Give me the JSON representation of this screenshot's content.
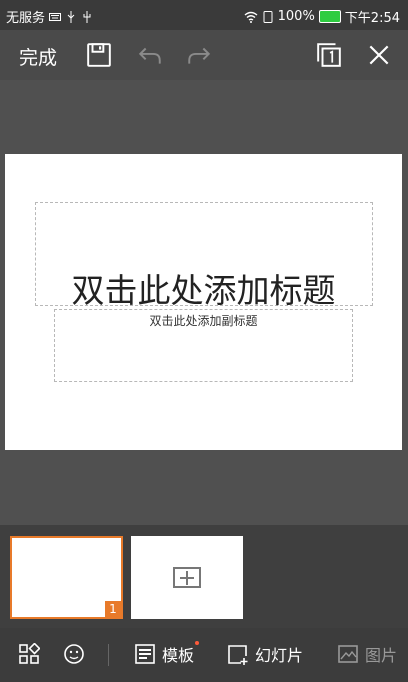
{
  "status": {
    "carrier": "无服务",
    "battery_pct": "100%",
    "time": "下午2:54"
  },
  "toolbar": {
    "done_label": "完成"
  },
  "slide": {
    "title_placeholder": "双击此处添加标题",
    "subtitle_placeholder": "双击此处添加副标题"
  },
  "thumbnails": {
    "slide_number": "1"
  },
  "bottombar": {
    "template_label": "模板",
    "slide_label": "幻灯片",
    "picture_label": "图片"
  }
}
